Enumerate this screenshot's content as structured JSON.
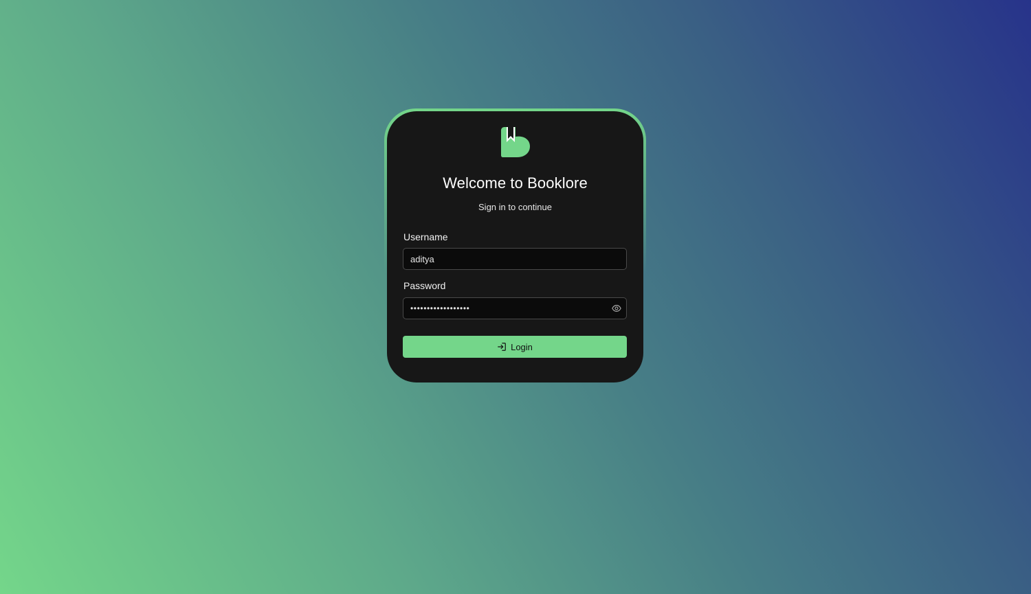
{
  "brand": {
    "logo_icon": "booklore-logo-icon",
    "accent_color": "#74d68a"
  },
  "login": {
    "title": "Welcome to Booklore",
    "subtitle": "Sign in to continue",
    "username_label": "Username",
    "username_value": "aditya",
    "password_label": "Password",
    "password_value": "••••••••••••••••••",
    "password_toggle_icon": "eye-icon",
    "login_button_label": "Login",
    "login_button_icon": "sign-in-icon"
  }
}
